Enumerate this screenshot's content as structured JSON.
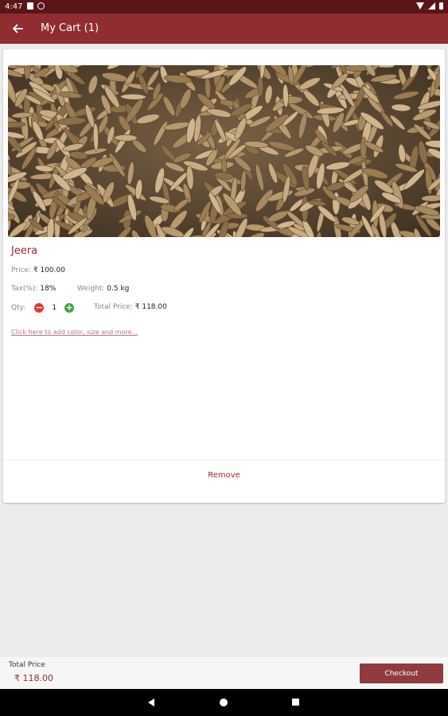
{
  "status_bar": {
    "time": "4:47",
    "left_icons": [
      "sd-card-icon",
      "at-sign-notification-icon"
    ],
    "right_icons": [
      "wifi-icon",
      "signal-icon",
      "battery-icon"
    ]
  },
  "app_bar": {
    "title": "My Cart (1)",
    "back_icon": "arrow-left-icon",
    "color": "#8f2d31"
  },
  "cart_item": {
    "image": "cumin-seeds-photo",
    "name": "Jeera",
    "price_label": "Price:",
    "price_value": "₹ 100.00",
    "tax_label": "Tax(%):",
    "tax_value": "18%",
    "weight_label": "Weight:",
    "weight_value": "0.5 kg",
    "qty_label": "Qty:",
    "qty_minus": "−",
    "qty_value": "1",
    "qty_plus": "+",
    "total_label": "Total Price:",
    "total_value": "₹ 118.00",
    "options_link": "Click here to add color, size and more...",
    "remove_label": "Remove"
  },
  "footer": {
    "total_label": "Total Price",
    "total_value": "₹ 118.00",
    "checkout_label": "Checkout"
  },
  "nav_bar": {
    "icons": [
      "nav-back-icon",
      "nav-home-icon",
      "nav-recents-icon"
    ]
  },
  "colors": {
    "primary": "#8f2d31",
    "status_bar": "#5a1518",
    "minus": "#e53935",
    "plus": "#43a047"
  }
}
